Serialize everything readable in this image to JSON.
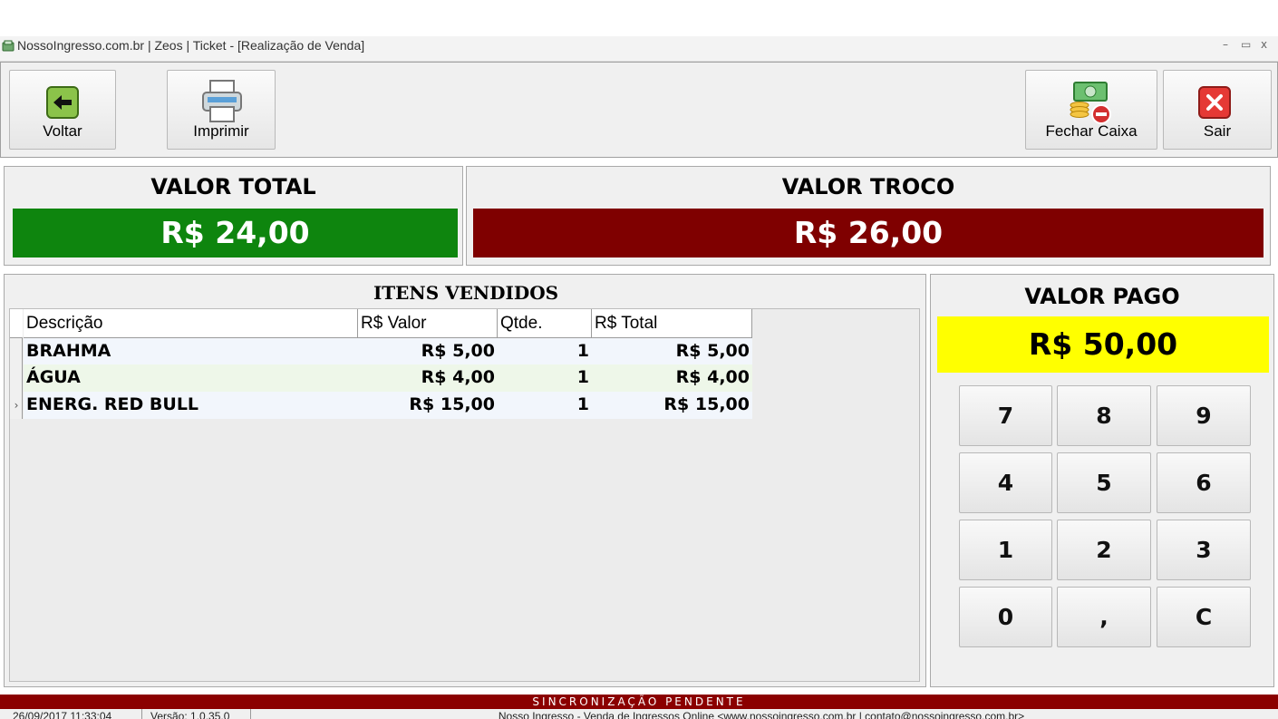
{
  "window": {
    "title": "NossoIngresso.com.br | Zeos | Ticket - [Realização de Venda]",
    "minimize": "–",
    "maximize": "▭",
    "close": "x"
  },
  "toolbar": {
    "back_label": "Voltar",
    "print_label": "Imprimir",
    "close_register_label": "Fechar Caixa",
    "exit_label": "Sair"
  },
  "summary": {
    "total_title": "VALOR TOTAL",
    "total_value": "R$ 24,00",
    "change_title": "VALOR TROCO",
    "change_value": "R$ 26,00",
    "total_color": "#0e850e",
    "change_color": "#7f0000"
  },
  "items": {
    "title": "ITENS VENDIDOS",
    "columns": [
      "Descrição",
      "R$ Valor",
      "Qtde.",
      "R$ Total"
    ],
    "rows": [
      {
        "desc": "BRAHMA",
        "value": "R$ 5,00",
        "qty": "1",
        "total": "R$ 5,00"
      },
      {
        "desc": "ÁGUA",
        "value": "R$ 4,00",
        "qty": "1",
        "total": "R$ 4,00"
      },
      {
        "desc": "ENERG. RED BULL",
        "value": "R$ 15,00",
        "qty": "1",
        "total": "R$ 15,00"
      }
    ],
    "current_row_marker": "›"
  },
  "payment": {
    "title": "VALOR PAGO",
    "value": "R$ 50,00",
    "highlight_color": "#ffff00"
  },
  "keypad": {
    "keys": [
      "7",
      "8",
      "9",
      "4",
      "5",
      "6",
      "1",
      "2",
      "3",
      "0",
      ",",
      "C"
    ]
  },
  "status": {
    "sync": "SINCRONIZAÇÃO PENDENTE",
    "datetime": "26/09/2017 11:33:04",
    "version": "Versão: 1.0.35.0",
    "footer": "Nosso Ingresso - Venda de Ingressos Online <www.nossoingresso.com.br | contato@nossoingresso.com.br>"
  },
  "icons": {
    "back": "arrow-left-icon",
    "print": "printer-icon",
    "close_register": "money-stack-icon",
    "exit": "close-x-icon"
  }
}
